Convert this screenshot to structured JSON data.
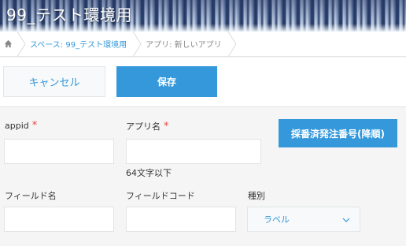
{
  "banner": {
    "title": "99_テスト環境用"
  },
  "breadcrumb": {
    "home_icon": "home-icon",
    "items": [
      "スペース: 99_テスト環境用",
      "アプリ: 新しいアプリ"
    ]
  },
  "toolbar": {
    "cancel_label": "キャンセル",
    "save_label": "保存"
  },
  "form": {
    "appid_label": "appid",
    "app_name_label": "アプリ名",
    "required_mark": "*",
    "app_name_hint": "64文字以下",
    "numbering_button": "採番済発注番号(降順)",
    "field_name_label": "フィールド名",
    "field_code_label": "フィールドコード",
    "type_label": "種別",
    "type_value": "ラベル"
  },
  "colors": {
    "accent": "#3498db",
    "required": "#e74c3c"
  }
}
